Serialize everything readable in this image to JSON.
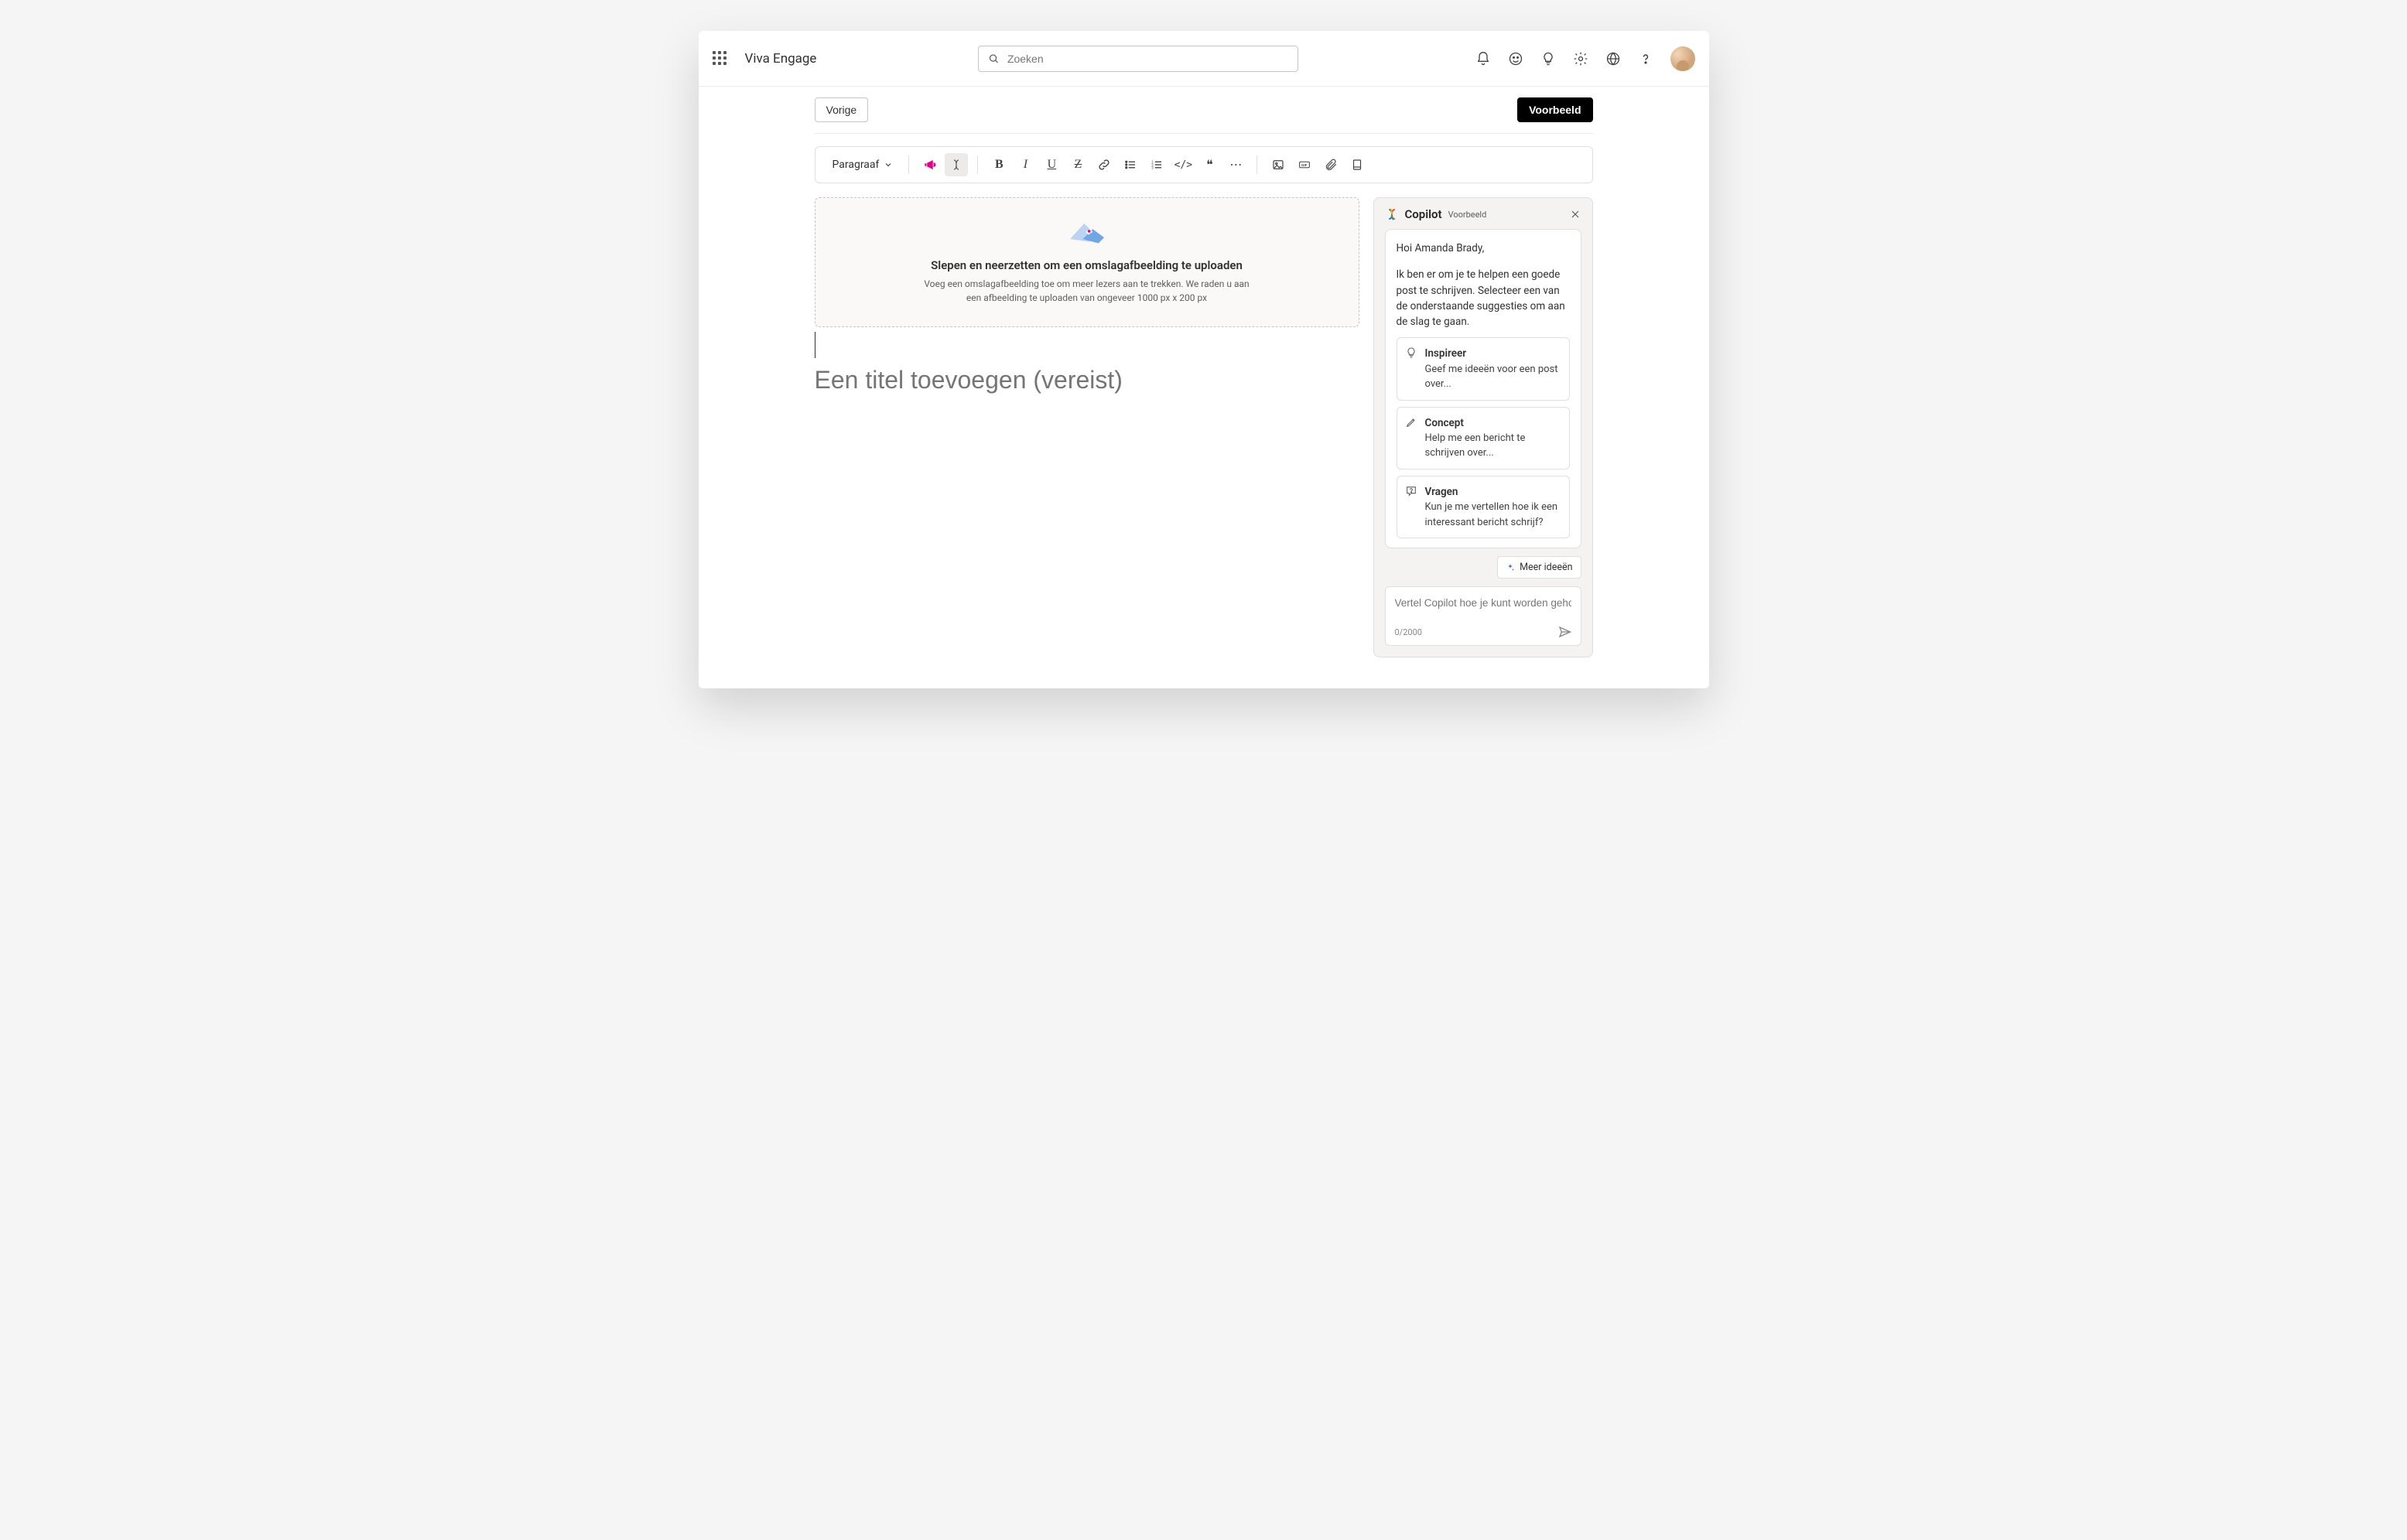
{
  "app": {
    "title": "Viva Engage"
  },
  "search": {
    "placeholder": "Zoeken"
  },
  "actions": {
    "back": "Vorige",
    "preview": "Voorbeeld"
  },
  "toolbar": {
    "paragraph": "Paragraaf"
  },
  "dropzone": {
    "title": "Slepen en neerzetten om een omslagafbeelding te uploaden",
    "line1": "Voeg een omslagafbeelding toe om meer lezers aan te trekken. We raden u aan",
    "line2": "een afbeelding te uploaden van ongeveer 1000 px x 200 px"
  },
  "editor": {
    "title_placeholder": "Een titel toevoegen (vereist)"
  },
  "copilot": {
    "name": "Copilot",
    "badge": "Voorbeeld",
    "greeting": "Hoi Amanda Brady,",
    "intro": "Ik ben er om je te helpen een goede post te schrijven. Selecteer een van de onderstaande suggesties om aan de slag te gaan.",
    "suggestions": [
      {
        "title": "Inspireer",
        "desc": "Geef me ideeën voor een post over..."
      },
      {
        "title": "Concept",
        "desc": "Help me een bericht te schrijven over..."
      },
      {
        "title": "Vragen",
        "desc": "Kun je me vertellen hoe ik een interessant bericht schrijf?"
      }
    ],
    "more": "Meer ideeën",
    "input_placeholder": "Vertel Copilot hoe je kunt worden geholpen",
    "counter": "0/2000"
  }
}
